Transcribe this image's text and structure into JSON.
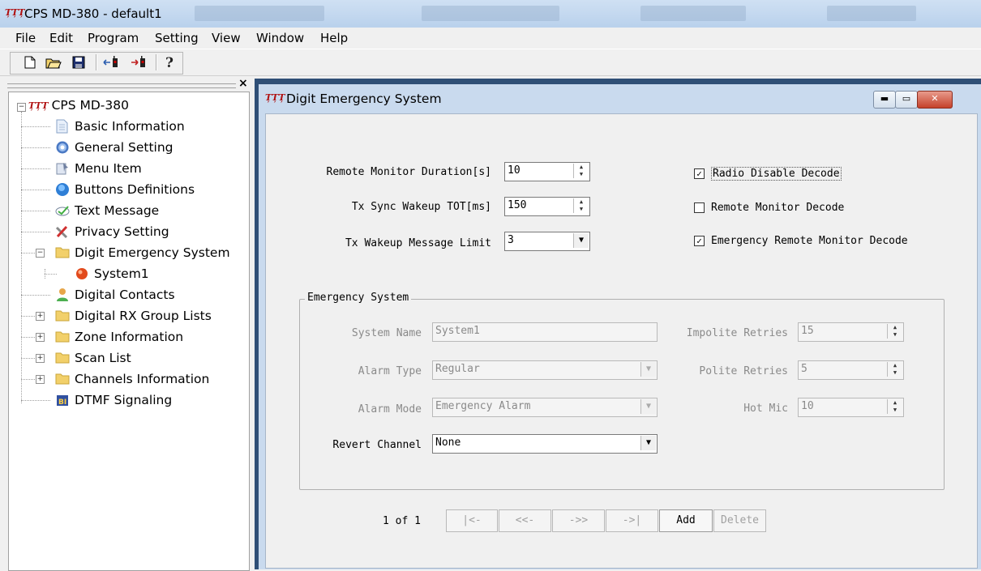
{
  "app": {
    "logo": "ȚȚȚ",
    "title": "CPS MD-380 - default1"
  },
  "menu": [
    "File",
    "Edit",
    "Program",
    "Setting",
    "View",
    "Window",
    "Help"
  ],
  "toolbar": [
    "new-icon",
    "open-icon",
    "save-icon",
    "read-radio-icon",
    "write-radio-icon",
    "help-icon"
  ],
  "tree": {
    "root": "CPS MD-380",
    "items": [
      {
        "label": "Basic Information",
        "icon": "document-icon"
      },
      {
        "label": "General Setting",
        "icon": "gear-icon"
      },
      {
        "label": "Menu Item",
        "icon": "menu-icon"
      },
      {
        "label": "Buttons Definitions",
        "icon": "button-icon"
      },
      {
        "label": "Text Message",
        "icon": "message-icon"
      },
      {
        "label": "Privacy Setting",
        "icon": "tools-icon"
      },
      {
        "label": "Digit Emergency System",
        "icon": "folder-icon"
      },
      {
        "label": "System1",
        "icon": "alarm-icon"
      },
      {
        "label": "Digital Contacts",
        "icon": "contact-icon"
      },
      {
        "label": "Digital RX Group Lists",
        "icon": "folder-icon"
      },
      {
        "label": "Zone Information",
        "icon": "folder-icon"
      },
      {
        "label": "Scan List",
        "icon": "folder-icon"
      },
      {
        "label": "Channels Information",
        "icon": "folder-icon"
      },
      {
        "label": "DTMF Signaling",
        "icon": "dtmf-icon"
      }
    ]
  },
  "child_window": {
    "title": "Digit Emergency System"
  },
  "form": {
    "remote_monitor_duration": {
      "label": "Remote Monitor Duration[s]",
      "value": "10"
    },
    "tx_sync_wakeup_tot": {
      "label": "Tx Sync Wakeup TOT[ms]",
      "value": "150"
    },
    "tx_wakeup_message_limit": {
      "label": "Tx Wakeup Message Limit",
      "value": "3"
    },
    "radio_disable_decode": {
      "label": "Radio Disable Decode",
      "checked": true
    },
    "remote_monitor_decode": {
      "label": "Remote Monitor Decode",
      "checked": false
    },
    "emergency_remote_monitor_decode": {
      "label": "Emergency Remote Monitor Decode",
      "checked": true
    }
  },
  "group": {
    "title": "Emergency System",
    "system_name": {
      "label": "System Name",
      "value": "System1"
    },
    "alarm_type": {
      "label": "Alarm Type",
      "value": "Regular"
    },
    "alarm_mode": {
      "label": "Alarm Mode",
      "value": "Emergency Alarm"
    },
    "revert_channel": {
      "label": "Revert Channel",
      "value": "None"
    },
    "impolite_retries": {
      "label": "Impolite Retries",
      "value": "15"
    },
    "polite_retries": {
      "label": "Polite Retries",
      "value": "5"
    },
    "hot_mic": {
      "label": "Hot Mic",
      "value": "10"
    }
  },
  "nav": {
    "page": "1 of 1",
    "first": "|<-",
    "prev": "<<-",
    "next": "->>",
    "last": "->|",
    "add": "Add",
    "delete": "Delete"
  }
}
